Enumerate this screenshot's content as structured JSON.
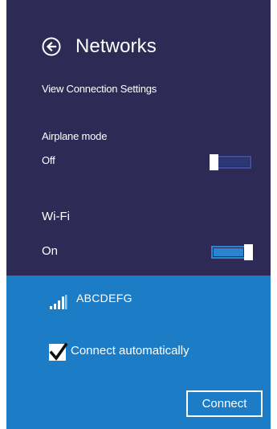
{
  "header": {
    "title": "Networks",
    "back_icon": "back-arrow-icon"
  },
  "view_connection_settings": "View Connection Settings",
  "airplane_mode": {
    "label": "Airplane mode",
    "state_label": "Off",
    "is_on": false
  },
  "wifi": {
    "label": "Wi-Fi",
    "state_label": "On",
    "is_on": true
  },
  "network": {
    "ssid": "ABCDEFG",
    "signal_icon": "signal-strength-icon",
    "connect_automatically_label": "Connect automatically",
    "connect_automatically_checked": true,
    "connect_button_label": "Connect"
  },
  "colors": {
    "panel_background": "#2d2b55",
    "network_background": "#1d7cc6",
    "toggle_on_accent": "#2a85d0",
    "text": "#ffffff"
  }
}
